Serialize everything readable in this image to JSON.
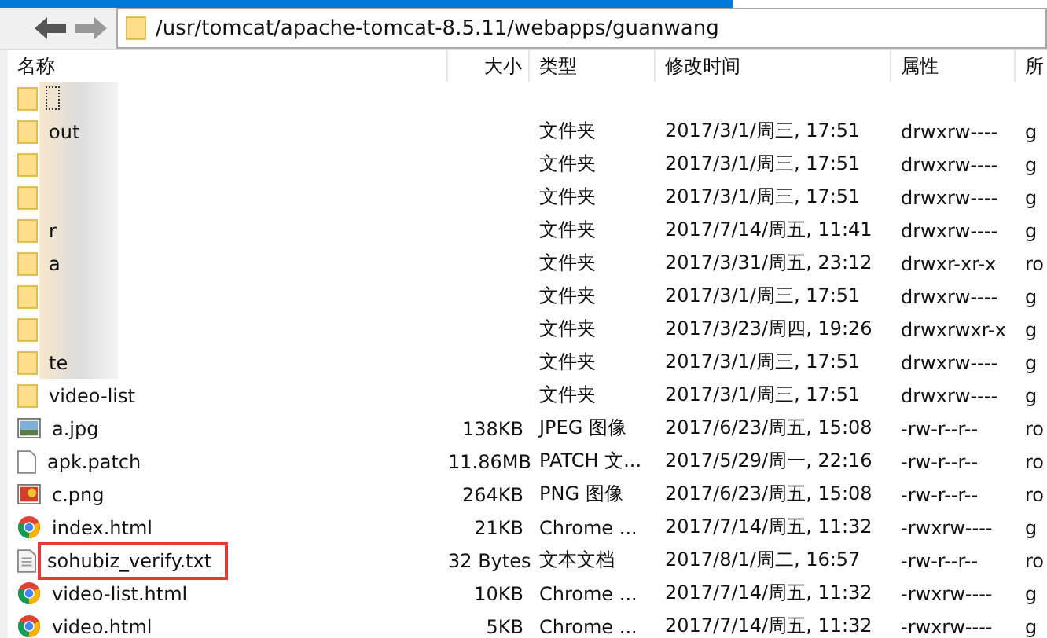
{
  "address": "/usr/tomcat/apache-tomcat-8.5.11/webapps/guanwang",
  "columns": [
    "名称",
    "大小",
    "类型",
    "修改时间",
    "属性",
    "所"
  ],
  "rows": [
    {
      "kind": "folder",
      "focused": true,
      "blurred": true
    },
    {
      "kind": "folder",
      "name": "out",
      "focused": false,
      "blurred": true,
      "type": "文件夹",
      "modified": "2017/3/1/周三, 17:51",
      "attrs": "drwxrw----",
      "owner": "g"
    },
    {
      "kind": "folder",
      "focused": false,
      "blurred": true,
      "type": "文件夹",
      "modified": "2017/3/1/周三, 17:51",
      "attrs": "drwxrw----",
      "owner": "g"
    },
    {
      "kind": "folder",
      "focused": false,
      "blurred": true,
      "type": "文件夹",
      "modified": "2017/3/1/周三, 17:51",
      "attrs": "drwxrw----",
      "owner": "g"
    },
    {
      "kind": "folder",
      "name": "r",
      "focused": false,
      "blurred": true,
      "type": "文件夹",
      "modified": "2017/7/14/周五, 11:41",
      "attrs": "drwxrw----",
      "owner": "g"
    },
    {
      "kind": "folder",
      "name": "a",
      "focused": false,
      "blurred": true,
      "type": "文件夹",
      "modified": "2017/3/31/周五, 23:12",
      "attrs": "drwxr-xr-x",
      "owner": "ro"
    },
    {
      "kind": "folder",
      "focused": false,
      "blurred": true,
      "type": "文件夹",
      "modified": "2017/3/1/周三, 17:51",
      "attrs": "drwxrw----",
      "owner": "g"
    },
    {
      "kind": "folder",
      "focused": false,
      "blurred": true,
      "type": "文件夹",
      "modified": "2017/3/23/周四, 19:26",
      "attrs": "drwxrwxr-x",
      "owner": "g"
    },
    {
      "kind": "folder",
      "name": "te",
      "focused": false,
      "blurred": true,
      "type": "文件夹",
      "modified": "2017/3/1/周三, 17:51",
      "attrs": "drwxrw----",
      "owner": "g"
    },
    {
      "kind": "folder",
      "name": "video-list",
      "focused": false,
      "blurred": false,
      "type": "文件夹",
      "modified": "2017/3/1/周三, 17:51",
      "attrs": "drwxrw----",
      "owner": "g"
    },
    {
      "kind": "image",
      "name": "a.jpg",
      "focused": false,
      "blurred": false,
      "highlighted": false,
      "size": "138KB",
      "type": "JPEG 图像",
      "modified": "2017/6/23/周五, 15:08",
      "attrs": "-rw-r--r--",
      "owner": "ro"
    },
    {
      "kind": "file",
      "name": "apk.patch",
      "focused": false,
      "blurred": false,
      "highlighted": false,
      "size": "11.86MB",
      "type": "PATCH 文...",
      "modified": "2017/5/29/周一, 22:16",
      "attrs": "-rw-r--r--",
      "owner": "ro"
    },
    {
      "kind": "photo",
      "name": "c.png",
      "focused": false,
      "blurred": false,
      "highlighted": false,
      "size": "264KB",
      "type": "PNG 图像",
      "modified": "2017/6/23/周五, 15:08",
      "attrs": "-rw-r--r--",
      "owner": "ro"
    },
    {
      "kind": "chrome",
      "name": "index.html",
      "focused": false,
      "blurred": false,
      "highlighted": false,
      "size": "21KB",
      "type": "Chrome ...",
      "modified": "2017/7/14/周五, 11:32",
      "attrs": "-rwxrw----",
      "owner": "g"
    },
    {
      "kind": "text",
      "name": "sohubiz_verify.txt",
      "focused": false,
      "blurred": false,
      "highlighted": true,
      "size": "32 Bytes",
      "type": "文本文档",
      "modified": "2017/8/1/周二, 16:57",
      "attrs": "-rw-r--r--",
      "owner": "ro"
    },
    {
      "kind": "chrome",
      "name": "video-list.html",
      "focused": false,
      "blurred": false,
      "highlighted": false,
      "size": "10KB",
      "type": "Chrome ...",
      "modified": "2017/7/14/周五, 11:32",
      "attrs": "-rwxrw----",
      "owner": "g"
    },
    {
      "kind": "chrome",
      "name": "video.html",
      "focused": false,
      "blurred": false,
      "highlighted": false,
      "size": "5KB",
      "type": "Chrome ...",
      "modified": "2017/7/14/周五, 11:32",
      "attrs": "-rwxrw----",
      "owner": "g"
    }
  ]
}
